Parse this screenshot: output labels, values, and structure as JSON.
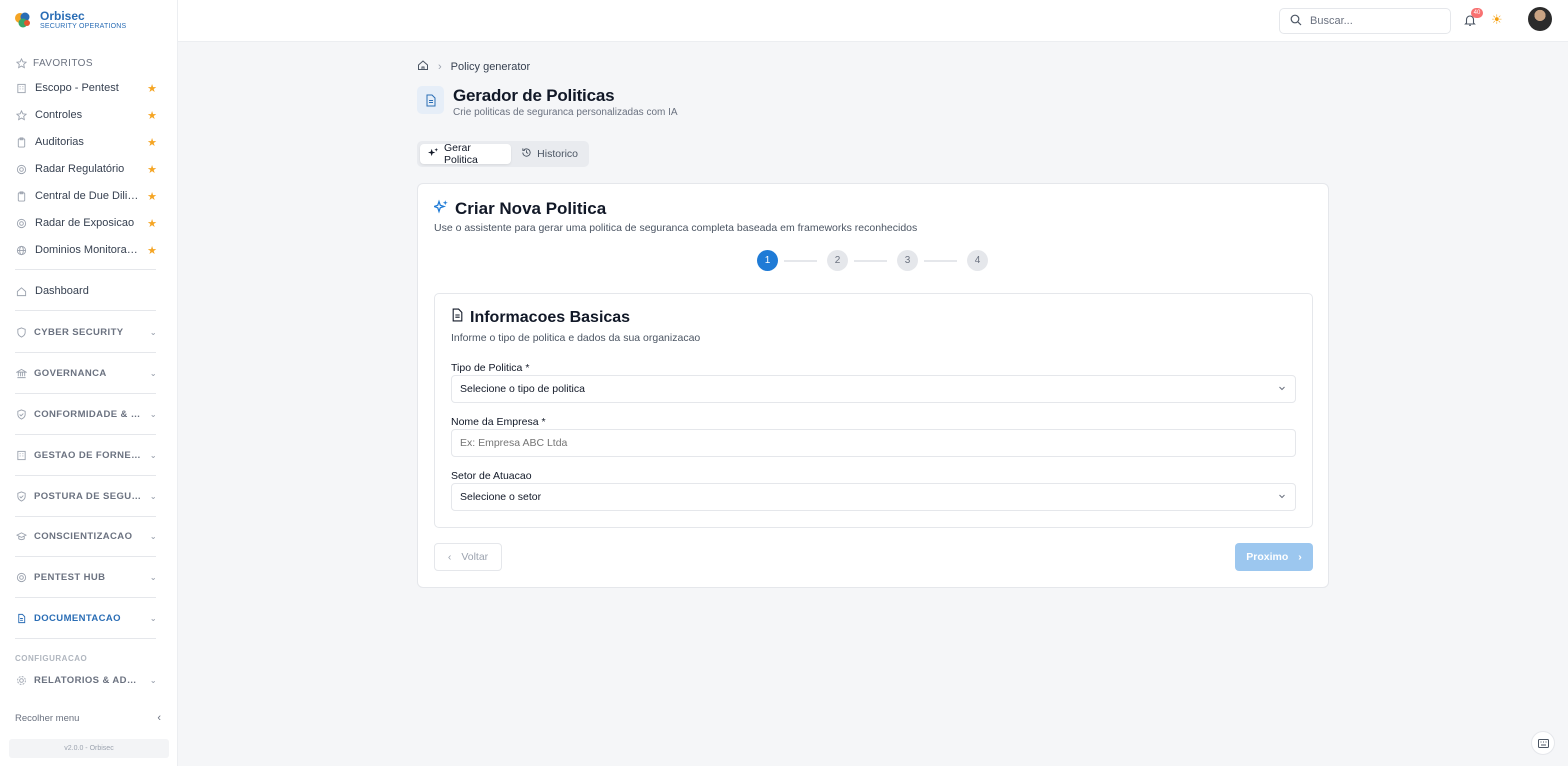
{
  "app": {
    "name": "Orbisec",
    "tagline": "SECURITY OPERATIONS",
    "version": "v2.0.0 - Orbisec"
  },
  "sidebar": {
    "favorites_label": "FAVORITOS",
    "favorites": [
      {
        "label": "Escopo - Pentest",
        "icon": "building-icon"
      },
      {
        "label": "Controles",
        "icon": "star-outline-icon"
      },
      {
        "label": "Auditorias",
        "icon": "clipboard-icon"
      },
      {
        "label": "Radar Regulatório",
        "icon": "radar-icon"
      },
      {
        "label": "Central de Due Dilige...",
        "icon": "clipboard-icon"
      },
      {
        "label": "Radar de Exposicao",
        "icon": "radar-icon"
      },
      {
        "label": "Dominios Monitorados",
        "icon": "globe-icon"
      }
    ],
    "dashboard_label": "Dashboard",
    "sections": [
      {
        "label": "CYBER SECURITY",
        "icon": "shield-icon",
        "active": false
      },
      {
        "label": "GOVERNANCA",
        "icon": "bank-icon",
        "active": false
      },
      {
        "label": "CONFORMIDADE & RIS...",
        "icon": "shield-check-icon",
        "active": false
      },
      {
        "label": "GESTAO DE FORNECE...",
        "icon": "building-icon",
        "active": false
      },
      {
        "label": "POSTURA DE SEGURA...",
        "icon": "shield-check-icon",
        "active": false
      },
      {
        "label": "CONSCIENTIZACAO",
        "icon": "graduation-cap-icon",
        "active": false
      },
      {
        "label": "PENTEST HUB",
        "icon": "target-icon",
        "active": false
      },
      {
        "label": "DOCUMENTACAO",
        "icon": "document-icon",
        "active": true
      }
    ],
    "config_label": "CONFIGURACAO",
    "config_section": {
      "label": "RELATORIOS & ADMIN",
      "icon": "gear-icon"
    },
    "collapse_label": "Recolher menu"
  },
  "topbar": {
    "search_placeholder": "Buscar...",
    "notification_count": "40"
  },
  "breadcrumb": {
    "current": "Policy generator"
  },
  "page": {
    "title": "Gerador de Politicas",
    "subtitle": "Crie politicas de seguranca personalizadas com IA"
  },
  "tabs": [
    {
      "label": "Gerar Politica",
      "active": true
    },
    {
      "label": "Historico",
      "active": false
    }
  ],
  "wizard": {
    "title": "Criar Nova Politica",
    "subtitle": "Use o assistente para gerar uma politica de seguranca completa baseada em frameworks reconhecidos",
    "steps": [
      "1",
      "2",
      "3",
      "4"
    ],
    "current_step": 1,
    "section": {
      "title": "Informacoes Basicas",
      "subtitle": "Informe o tipo de politica e dados da sua organizacao",
      "policy_type_label": "Tipo de Politica *",
      "policy_type_value": "Selecione o tipo de politica",
      "company_label": "Nome da Empresa *",
      "company_placeholder": "Ex: Empresa ABC Ltda",
      "sector_label": "Setor de Atuacao",
      "sector_value": "Selecione o setor"
    },
    "back_label": "Voltar",
    "next_label": "Proximo"
  },
  "colors": {
    "primary": "#1f7bd6",
    "star": "#f5a524",
    "next_disabled": "#9cc7ef"
  }
}
